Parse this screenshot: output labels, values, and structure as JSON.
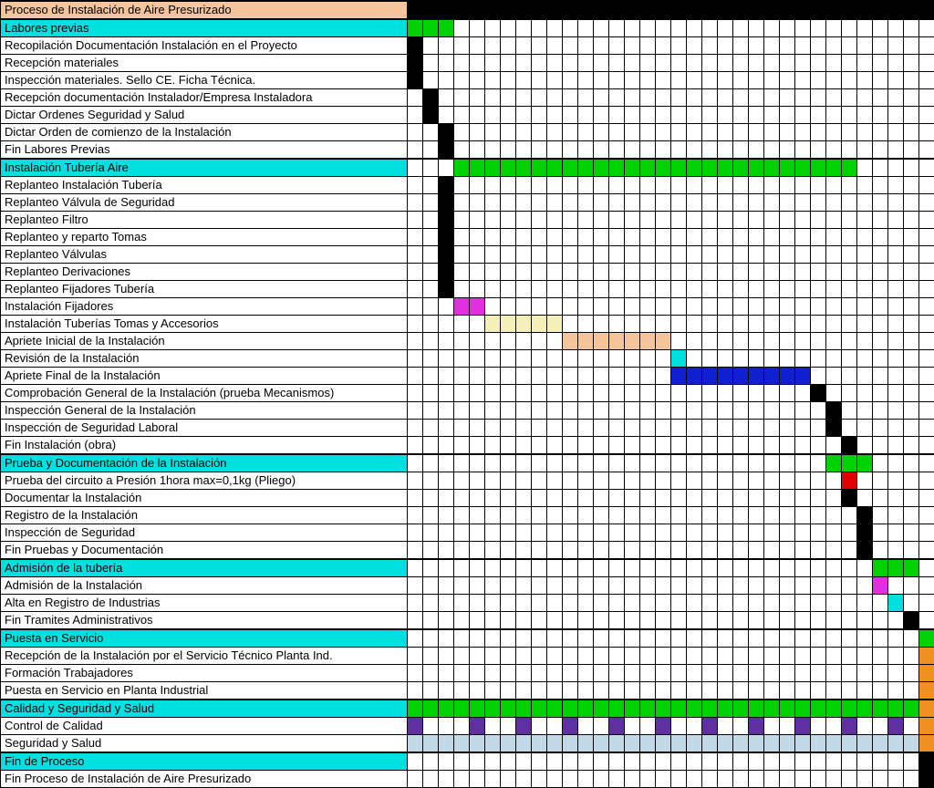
{
  "chart_data": {
    "type": "gantt",
    "columns": 34,
    "title": "Proceso de Instalación de Aire Presurizado",
    "colors": {
      "black": "#000000",
      "green": "#00D100",
      "cyan": "#00E0E0",
      "peach": "#F4C49A",
      "magenta": "#E030E0",
      "cream": "#F5F0B8",
      "blue": "#1020D0",
      "red": "#E00000",
      "orange": "#F09020",
      "purple": "#6030A0",
      "ltblue": "#C0D8E8"
    },
    "rows": [
      {
        "label": "Proceso de Instalación de Aire Presurizado",
        "labelColor": "peach",
        "section": true,
        "bars": [
          {
            "start": 0,
            "end": 34,
            "color": "black"
          }
        ]
      },
      {
        "label": "Labores previas",
        "labelColor": "cyan",
        "section": true,
        "bars": [
          {
            "start": 0,
            "end": 3,
            "color": "green"
          }
        ]
      },
      {
        "label": "Recopilación Documentación Instalación en el Proyecto",
        "bars": [
          {
            "start": 0,
            "end": 1,
            "color": "black"
          }
        ]
      },
      {
        "label": "Recepción materiales",
        "bars": [
          {
            "start": 0,
            "end": 1,
            "color": "black"
          }
        ]
      },
      {
        "label": "Inspección materiales. Sello CE. Ficha Técnica.",
        "bars": [
          {
            "start": 0,
            "end": 1,
            "color": "black"
          }
        ]
      },
      {
        "label": "Recepción documentación Instalador/Empresa Instaladora",
        "bars": [
          {
            "start": 1,
            "end": 2,
            "color": "black"
          }
        ]
      },
      {
        "label": "Dictar Ordenes Seguridad y Salud",
        "bars": [
          {
            "start": 1,
            "end": 2,
            "color": "black"
          }
        ]
      },
      {
        "label": "Dictar Orden de comienzo de la Instalación",
        "bars": [
          {
            "start": 2,
            "end": 3,
            "color": "black"
          }
        ]
      },
      {
        "label": "Fin Labores Previas",
        "bars": [
          {
            "start": 2,
            "end": 3,
            "color": "black"
          }
        ]
      },
      {
        "label": "Instalación Tubería Aire",
        "labelColor": "cyan",
        "section": true,
        "bars": [
          {
            "start": 3,
            "end": 29,
            "color": "green"
          }
        ]
      },
      {
        "label": "Replanteo Instalación Tubería",
        "bars": [
          {
            "start": 2,
            "end": 3,
            "color": "black"
          }
        ]
      },
      {
        "label": "Replanteo Válvula de Seguridad",
        "bars": [
          {
            "start": 2,
            "end": 3,
            "color": "black"
          }
        ]
      },
      {
        "label": "Replanteo Filtro",
        "bars": [
          {
            "start": 2,
            "end": 3,
            "color": "black"
          }
        ]
      },
      {
        "label": "Replanteo y reparto Tomas",
        "bars": [
          {
            "start": 2,
            "end": 3,
            "color": "black"
          }
        ]
      },
      {
        "label": "Replanteo Válvulas",
        "bars": [
          {
            "start": 2,
            "end": 3,
            "color": "black"
          }
        ]
      },
      {
        "label": "Replanteo Derivaciones",
        "bars": [
          {
            "start": 2,
            "end": 3,
            "color": "black"
          }
        ]
      },
      {
        "label": "Replanteo Fijadores Tubería",
        "bars": [
          {
            "start": 2,
            "end": 3,
            "color": "black"
          }
        ]
      },
      {
        "label": "Instalación Fijadores",
        "bars": [
          {
            "start": 3,
            "end": 5,
            "color": "magenta"
          }
        ]
      },
      {
        "label": "Instalación Tuberías Tomas y Accesorios",
        "bars": [
          {
            "start": 5,
            "end": 10,
            "color": "cream"
          }
        ]
      },
      {
        "label": "Apriete Inicial de la Instalación",
        "bars": [
          {
            "start": 10,
            "end": 17,
            "color": "peach"
          }
        ]
      },
      {
        "label": "Revisión de la Instalación",
        "bars": [
          {
            "start": 17,
            "end": 18,
            "color": "cyan"
          }
        ]
      },
      {
        "label": "Apriete Final de la Instalación",
        "bars": [
          {
            "start": 17,
            "end": 26,
            "color": "blue"
          }
        ]
      },
      {
        "label": "Comprobación General de la Instalación (prueba Mecanismos)",
        "bars": [
          {
            "start": 26,
            "end": 27,
            "color": "black"
          }
        ]
      },
      {
        "label": "Inspección General de la Instalación",
        "bars": [
          {
            "start": 27,
            "end": 28,
            "color": "black"
          }
        ]
      },
      {
        "label": "Inspección de Seguridad Laboral",
        "bars": [
          {
            "start": 27,
            "end": 28,
            "color": "black"
          }
        ]
      },
      {
        "label": "Fin Instalación (obra)",
        "bars": [
          {
            "start": 28,
            "end": 29,
            "color": "black"
          }
        ]
      },
      {
        "label": "Prueba y Documentación de la Instalación",
        "labelColor": "cyan",
        "section": true,
        "bars": [
          {
            "start": 27,
            "end": 30,
            "color": "green"
          }
        ]
      },
      {
        "label": "Prueba del circuito a Presión 1hora max=0,1kg (Pliego)",
        "bars": [
          {
            "start": 28,
            "end": 29,
            "color": "red"
          }
        ]
      },
      {
        "label": "Documentar la Instalación",
        "bars": [
          {
            "start": 28,
            "end": 29,
            "color": "black"
          }
        ]
      },
      {
        "label": "Registro de la Instalación",
        "bars": [
          {
            "start": 29,
            "end": 30,
            "color": "black"
          }
        ]
      },
      {
        "label": "Inspección de Seguridad",
        "bars": [
          {
            "start": 29,
            "end": 30,
            "color": "black"
          }
        ]
      },
      {
        "label": "Fin Pruebas y Documentación",
        "bars": [
          {
            "start": 29,
            "end": 30,
            "color": "black"
          }
        ]
      },
      {
        "label": "Admisión de la tubería",
        "labelColor": "cyan",
        "section": true,
        "bars": [
          {
            "start": 30,
            "end": 33,
            "color": "green"
          }
        ]
      },
      {
        "label": "Admisión de la Instalación",
        "bars": [
          {
            "start": 30,
            "end": 31,
            "color": "magenta"
          }
        ]
      },
      {
        "label": "Alta en Registro de Industrias",
        "bars": [
          {
            "start": 31,
            "end": 32,
            "color": "cyan"
          }
        ]
      },
      {
        "label": "Fin Tramites Administrativos",
        "bars": [
          {
            "start": 32,
            "end": 33,
            "color": "black"
          }
        ]
      },
      {
        "label": "Puesta en Servicio",
        "labelColor": "cyan",
        "section": true,
        "bars": [
          {
            "start": 33,
            "end": 34,
            "color": "green"
          }
        ]
      },
      {
        "label": "Recepción de la Instalación por el Servicio Técnico Planta Ind.",
        "bars": [
          {
            "start": 33,
            "end": 34,
            "color": "orange"
          }
        ]
      },
      {
        "label": "Formación Trabajadores",
        "bars": [
          {
            "start": 33,
            "end": 34,
            "color": "orange"
          }
        ]
      },
      {
        "label": "Puesta en Servicio en Planta Industrial",
        "bars": [
          {
            "start": 33,
            "end": 34,
            "color": "orange"
          }
        ]
      },
      {
        "label": "Calidad y Seguridad y Salud",
        "labelColor": "cyan",
        "section": true,
        "bars": [
          {
            "start": 0,
            "end": 33,
            "color": "green"
          },
          {
            "start": 33,
            "end": 34,
            "color": "orange"
          }
        ]
      },
      {
        "label": "Control de Calidad",
        "bars": [
          {
            "start": 0,
            "end": 1,
            "color": "purple"
          },
          {
            "start": 4,
            "end": 5,
            "color": "purple"
          },
          {
            "start": 7,
            "end": 8,
            "color": "purple"
          },
          {
            "start": 10,
            "end": 11,
            "color": "purple"
          },
          {
            "start": 13,
            "end": 14,
            "color": "purple"
          },
          {
            "start": 16,
            "end": 17,
            "color": "purple"
          },
          {
            "start": 19,
            "end": 20,
            "color": "purple"
          },
          {
            "start": 22,
            "end": 23,
            "color": "purple"
          },
          {
            "start": 25,
            "end": 26,
            "color": "purple"
          },
          {
            "start": 28,
            "end": 29,
            "color": "purple"
          },
          {
            "start": 31,
            "end": 32,
            "color": "purple"
          },
          {
            "start": 33,
            "end": 34,
            "color": "orange"
          }
        ]
      },
      {
        "label": "Seguridad y Salud",
        "bars": [
          {
            "start": 0,
            "end": 33,
            "color": "ltblue"
          },
          {
            "start": 33,
            "end": 34,
            "color": "orange"
          }
        ]
      },
      {
        "label": "Fin de Proceso",
        "labelColor": "cyan",
        "section": true,
        "bars": [
          {
            "start": 33,
            "end": 34,
            "color": "black"
          }
        ]
      },
      {
        "label": "Fin Proceso de Instalación de Aire Presurizado",
        "bars": [
          {
            "start": 33,
            "end": 34,
            "color": "black"
          }
        ]
      }
    ]
  }
}
